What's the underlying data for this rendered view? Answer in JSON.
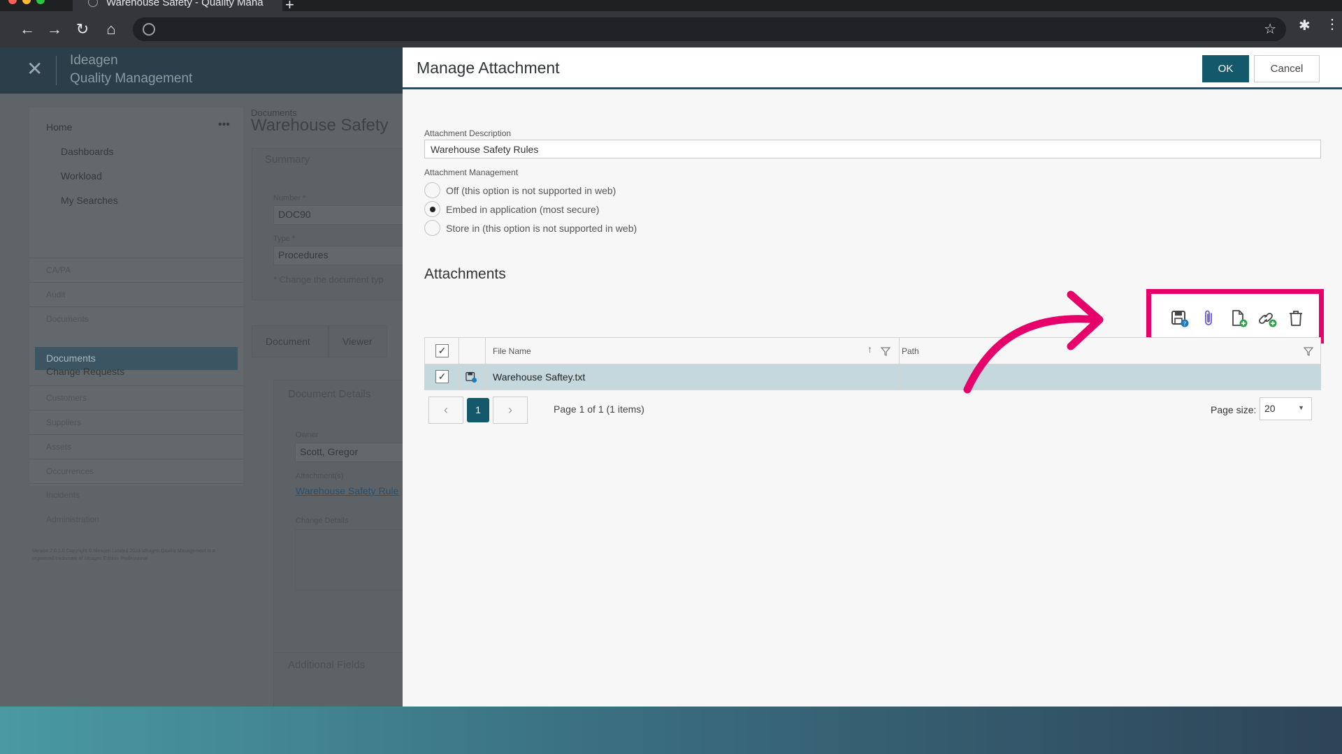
{
  "browser": {
    "tab_title": "Warehouse Safety - Quality Mana",
    "new_tab": "+",
    "back_icon": "arrow-left-icon",
    "forward_icon": "arrow-right-icon",
    "reload_icon": "reload-icon",
    "home_icon": "home-icon"
  },
  "app": {
    "brand_top": "Ideagen",
    "brand_bottom": "Quality Management",
    "close": "✕",
    "nav": {
      "home": "Home",
      "more": "•••",
      "dashboards": "Dashboards",
      "workload": "Workload",
      "my_searches": "My Searches",
      "capa": "CA/PA",
      "audit": "Audit",
      "documents_header": "Documents",
      "documents": "Documents",
      "change_requests": "Change Requests",
      "customers": "Customers",
      "suppliers": "Suppliers",
      "assets": "Assets",
      "occurrences": "Occurrences",
      "incidents": "Incidents",
      "administration": "Administration"
    },
    "footer": "Version 7.0.1.0 Copyright © Ideagen Limited 2024 Ideagen Quality Management is a registered trademark of Ideagen Edition: Professional",
    "breadcrumb": "Documents",
    "page_title": "Warehouse Safety",
    "summary": "Summary",
    "number_label": "Number *",
    "number_value": "DOC90",
    "type_label": "Type *",
    "type_value": "Procedures",
    "type_note": "* Change the document typ",
    "tab_document": "Document",
    "tab_viewer": "Viewer",
    "doc_details": "Document Details",
    "owner_label": "Owner",
    "owner_value": "Scott, Gregor",
    "attachments_label": "Attachment(s)",
    "attachments_link": "Warehouse Safety Rule",
    "change_details": "Change Details",
    "additional_fields": "Additional Fields"
  },
  "modal": {
    "title": "Manage Attachment",
    "ok": "OK",
    "cancel": "Cancel",
    "desc_label": "Attachment Description",
    "desc_value": "Warehouse Safety Rules",
    "mgmt_label": "Attachment Management",
    "options": [
      "Off (this option is not supported in web)",
      "Embed in application (most secure)",
      "Store in (this option is not supported in web)"
    ],
    "selected_option": 1,
    "attachments_title": "Attachments",
    "toolbar": [
      "save-attachment-icon",
      "attach-file-icon",
      "add-file-icon",
      "add-link-icon",
      "delete-icon"
    ],
    "grid": {
      "headers": [
        "File Name",
        "Path"
      ],
      "rows": [
        {
          "file_name": "Warehouse Saftey.txt",
          "path": ""
        }
      ]
    },
    "pager": {
      "prev": "‹",
      "current": "1",
      "next": "›",
      "info": "Page 1 of 1 (1 items)",
      "size_label": "Page size:",
      "size_value": "20"
    }
  },
  "colors": {
    "accent": "#14596b",
    "highlight": "#e5006a"
  }
}
